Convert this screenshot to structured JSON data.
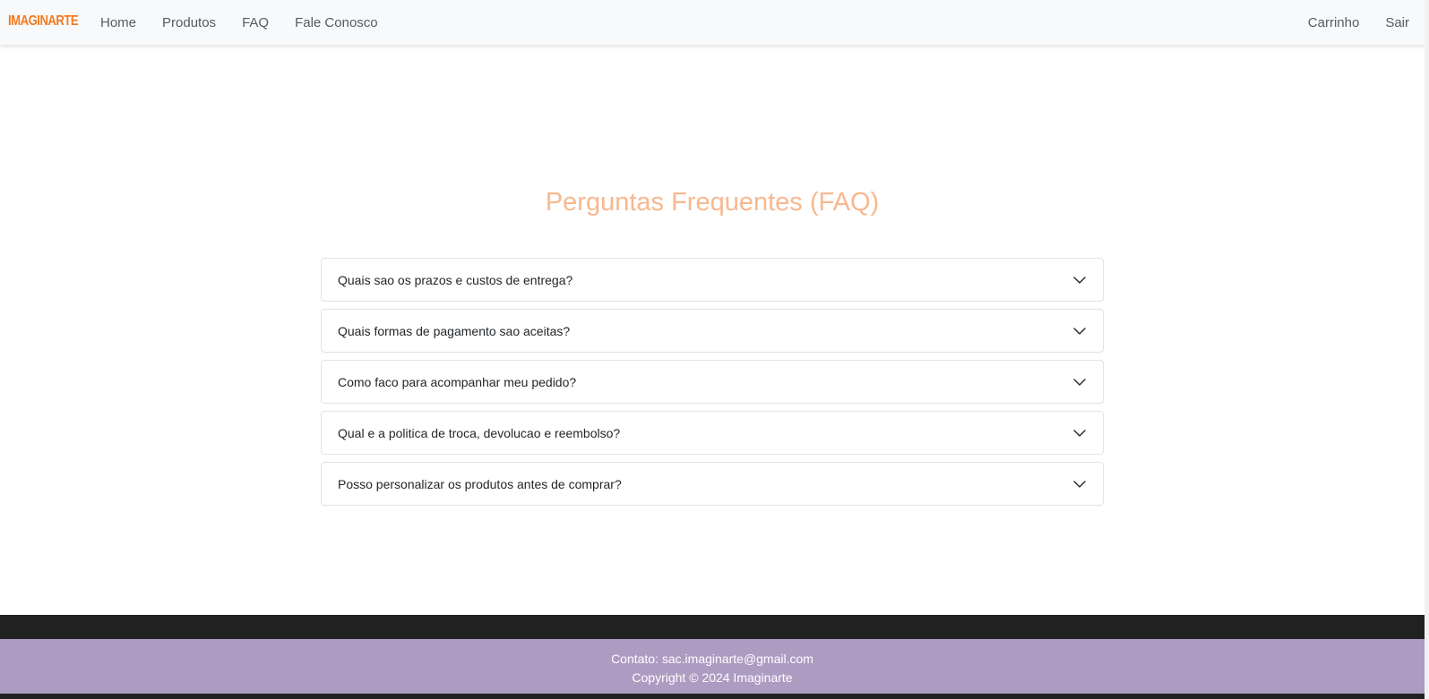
{
  "nav": {
    "brand": "IMAGINARTE",
    "links": [
      "Home",
      "Produtos",
      "FAQ",
      "Fale Conosco"
    ],
    "right_links": [
      "Carrinho",
      "Sair"
    ]
  },
  "faq": {
    "title": "Perguntas Frequentes (FAQ)",
    "questions": [
      "Quais sao os prazos e custos de entrega?",
      "Quais formas de pagamento sao aceitas?",
      "Como faco para acompanhar meu pedido?",
      "Qual e a politica de troca, devolucao e reembolso?",
      "Posso personalizar os produtos antes de comprar?"
    ]
  },
  "footer": {
    "contact": "Contato: sac.imaginarte@gmail.com",
    "copyright": "Copyright © 2024 Imaginarte"
  },
  "colors": {
    "brand": "#f47a20",
    "title": "#f7b88f",
    "footer_bg": "#ad9bc2",
    "footer_dark": "#212121",
    "navbar_bg": "#f8f9fa"
  }
}
